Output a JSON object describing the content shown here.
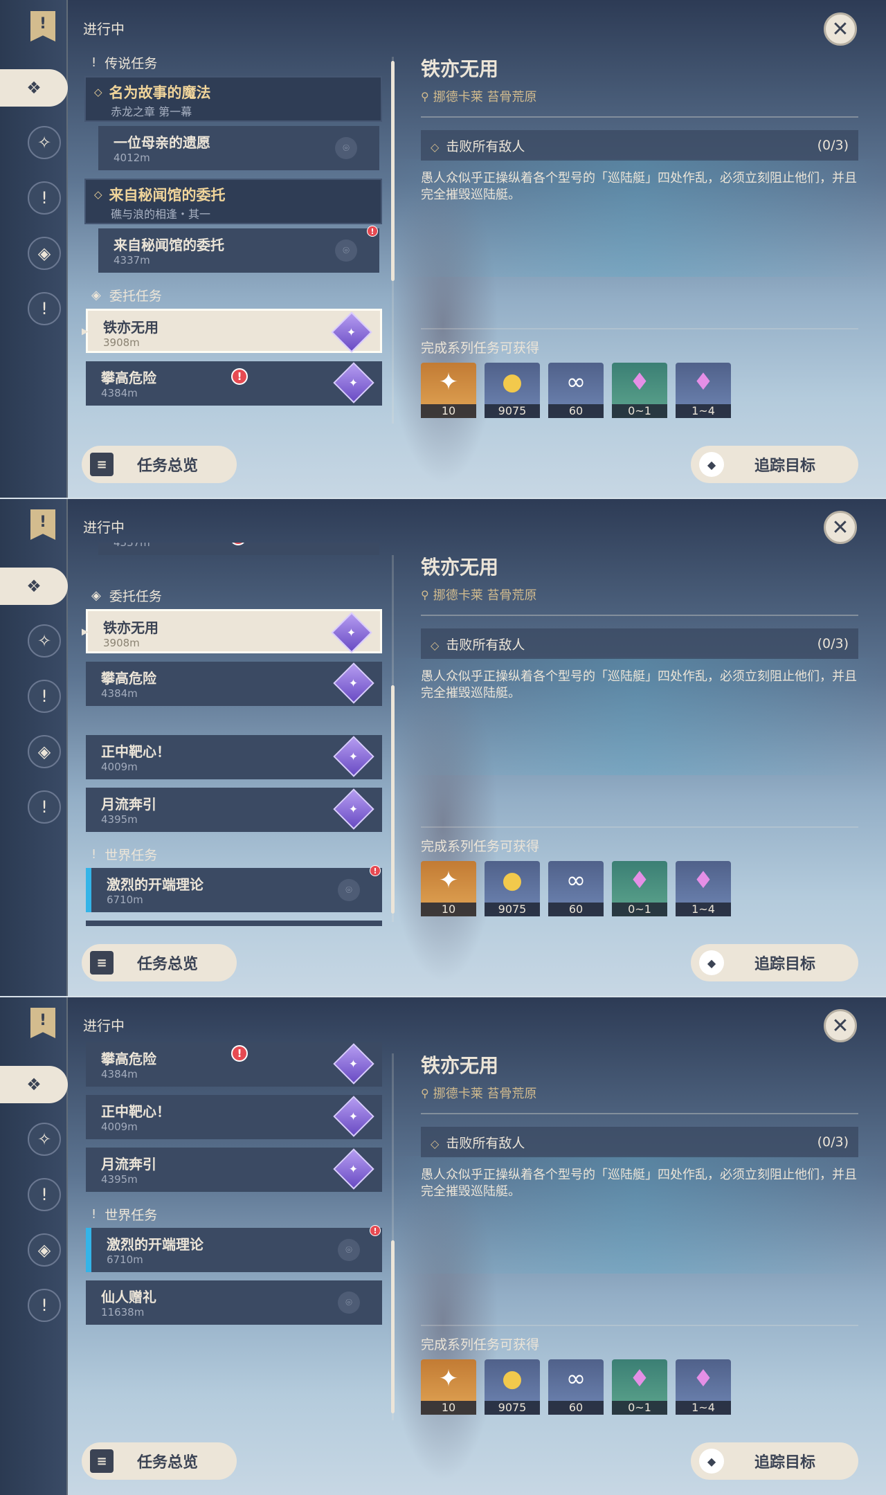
{
  "header": {
    "label": "进行中"
  },
  "sidebar": {
    "bookmark": "!",
    "icons": [
      "quest-list-icon",
      "archon-quest-icon",
      "story-quest-icon",
      "commission-icon",
      "world-quest-icon"
    ]
  },
  "sections": {
    "legend": "传说任务",
    "commission": "委托任务",
    "world": "世界任务"
  },
  "groups": {
    "legend1": {
      "title": "名为故事的魔法",
      "subtitle": "赤龙之章 第一幕"
    },
    "legend2": {
      "title": "来自秘闻馆的委托",
      "subtitle": "礁与浪的相逢・其一"
    }
  },
  "quests": {
    "mother": {
      "title": "一位母亲的遗愿",
      "distance": "4012m"
    },
    "secret": {
      "title": "来自秘闻馆的委托",
      "distance": "4337m"
    },
    "iron": {
      "title": "铁亦无用",
      "distance": "3908m"
    },
    "climb": {
      "title": "攀高危险",
      "distance": "4384m"
    },
    "target": {
      "title": "正中靶心！",
      "distance": "4009m"
    },
    "moon": {
      "title": "月流奔引",
      "distance": "4395m"
    },
    "fierce": {
      "title": "激烈的开端理论",
      "distance": "6710m"
    },
    "gift": {
      "title": "仙人赠礼",
      "distance": "11638m"
    }
  },
  "buttons": {
    "overview": "任务总览",
    "track": "追踪目标"
  },
  "detail": {
    "title": "铁亦无用",
    "location": "挪德卡莱 苔骨荒原",
    "objective": "击败所有敌人",
    "progress": "(0/3)",
    "description": "愚人众似乎正操纵着各个型号的「巡陆艇」四处作乱，必须立刻阻止他们，并且完全摧毁巡陆艇。",
    "rewards_label": "完成系列任务可获得",
    "rewards": [
      {
        "icon": "primogem-icon",
        "count": "10"
      },
      {
        "icon": "mora-icon",
        "count": "9075"
      },
      {
        "icon": "fate-icon",
        "count": "60"
      },
      {
        "icon": "crystal-chunk-icon",
        "count": "0~1"
      },
      {
        "icon": "crystal-icon",
        "count": "1~4"
      }
    ]
  },
  "colors": {
    "accent": "#d3bc8e",
    "card": "#3b4a63",
    "active": "#ece5d8",
    "alert": "#e64a52",
    "world_marker": "#34b4e8"
  }
}
